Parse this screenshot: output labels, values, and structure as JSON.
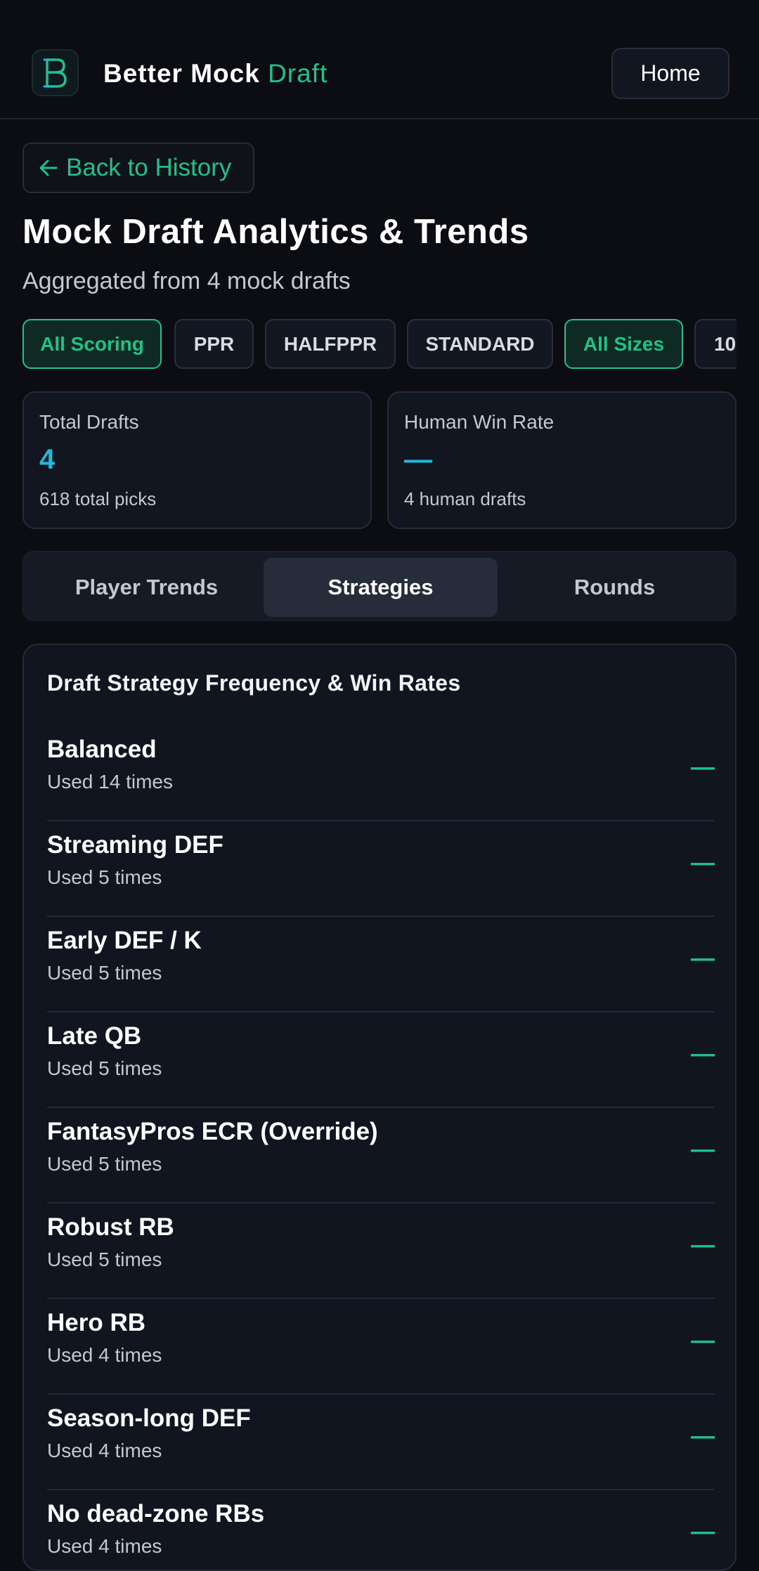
{
  "header": {
    "brand_part1": "Better Mock",
    "brand_part2": "Draft",
    "home_label": "Home"
  },
  "back_label": "Back to History",
  "page": {
    "title": "Mock Draft Analytics & Trends",
    "subtitle": "Aggregated from 4 mock drafts"
  },
  "filters": [
    {
      "label": "All Scoring",
      "active": true
    },
    {
      "label": "PPR",
      "active": false
    },
    {
      "label": "HALFPPR",
      "active": false
    },
    {
      "label": "STANDARD",
      "active": false
    },
    {
      "label": "All Sizes",
      "active": true
    },
    {
      "label": "10",
      "active": false
    }
  ],
  "stats": {
    "total": {
      "label": "Total Drafts",
      "value": "4",
      "sub": "618 total picks"
    },
    "winrate": {
      "label": "Human Win Rate",
      "value": "—",
      "sub": "4 human drafts"
    }
  },
  "tabs": [
    {
      "label": "Player Trends",
      "active": false
    },
    {
      "label": "Strategies",
      "active": true
    },
    {
      "label": "Rounds",
      "active": false
    }
  ],
  "panel": {
    "title": "Draft Strategy Frequency & Win Rates",
    "strategies": [
      {
        "name": "Balanced",
        "usage": "Used 14 times",
        "rate": "—"
      },
      {
        "name": "Streaming DEF",
        "usage": "Used 5 times",
        "rate": "—"
      },
      {
        "name": "Early DEF / K",
        "usage": "Used 5 times",
        "rate": "—"
      },
      {
        "name": "Late QB",
        "usage": "Used 5 times",
        "rate": "—"
      },
      {
        "name": "FantasyPros ECR (Override)",
        "usage": "Used 5 times",
        "rate": "—"
      },
      {
        "name": "Robust RB",
        "usage": "Used 5 times",
        "rate": "—"
      },
      {
        "name": "Hero RB",
        "usage": "Used 4 times",
        "rate": "—"
      },
      {
        "name": "Season-long DEF",
        "usage": "Used 4 times",
        "rate": "—"
      },
      {
        "name": "No dead-zone RBs",
        "usage": "Used 4 times",
        "rate": "—"
      }
    ]
  },
  "colors": {
    "accent": "#22c08a",
    "stat_value": "#22b8d8",
    "background": "#0b0d12"
  }
}
